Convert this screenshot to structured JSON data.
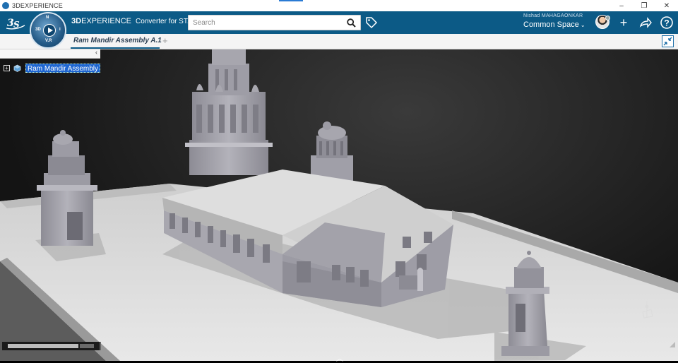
{
  "window": {
    "title": "3DEXPERIENCE",
    "controls": [
      "minimize",
      "maximize",
      "close"
    ]
  },
  "topbar": {
    "brand_bold": "3D",
    "brand_rest": "EXPERIENCE",
    "app_name": "Converter for ST...",
    "compass_label": "V.R",
    "search_placeholder": "Search",
    "user_name": "Nishad MAHAGAONKAR",
    "space": "Common Space",
    "icons": [
      "3ds-logo",
      "compass",
      "search-icon",
      "tag-icon",
      "avatar",
      "plus-icon",
      "share-icon",
      "help-icon"
    ]
  },
  "tabs": [
    {
      "label": "Ram Mandir Assembly A.1",
      "active": true
    }
  ],
  "tree": {
    "root_label": "Ram Mandir Assembly",
    "collapse_glyph": "‹"
  },
  "viewport": {
    "progress_fraction": 0.82,
    "colors": {
      "accent": "#0c5a86",
      "selection": "#1f66d1"
    }
  }
}
